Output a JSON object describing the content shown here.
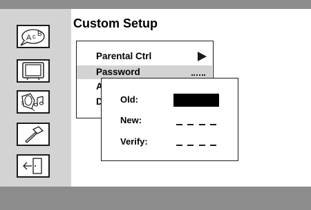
{
  "screen": {
    "title": "Custom Setup",
    "colors": {
      "bar": "#8c8c8c",
      "panel": "#d3d3d3",
      "selection": "#d3d3d3"
    }
  },
  "sidebar": {
    "icons": [
      {
        "name": "language-abc-icon",
        "text": "A c B"
      },
      {
        "name": "tv-screen-icon"
      },
      {
        "name": "audio-speaker-music-icon"
      },
      {
        "name": "hammer-tool-icon"
      },
      {
        "name": "exit-door-icon"
      }
    ]
  },
  "menu": {
    "items": [
      {
        "label": "Parental Ctrl",
        "indicator": "arrow"
      },
      {
        "label": "Password",
        "indicator": "dots",
        "selected": true
      },
      {
        "label": "A"
      },
      {
        "label": "D"
      }
    ]
  },
  "password_dialog": {
    "old_label": "Old:",
    "new_label": "New:",
    "verify_label": "Verify:"
  }
}
